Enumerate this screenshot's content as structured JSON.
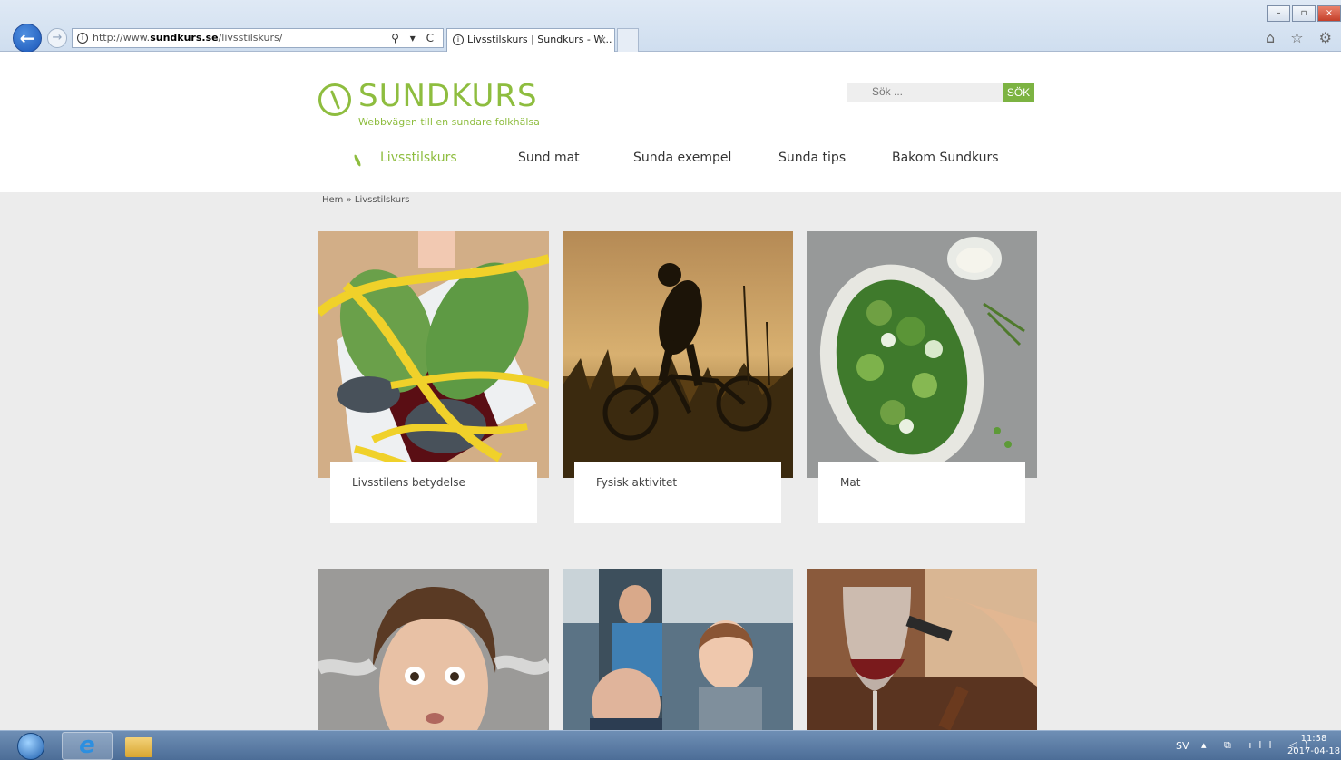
{
  "browser": {
    "url_prefix": "http://www.",
    "url_domain": "sundkurs.se",
    "url_path": "/livsstilskurs/",
    "address_tools": "⚲ ▾ C",
    "tab_title": "Livsstilskurs | Sundkurs - W...",
    "tab_close": "×",
    "win_minimize": "–",
    "win_restore": "▫",
    "win_close": "×",
    "chrome_icons": "⌂ ☆ ⚙"
  },
  "site": {
    "logo_text": "SUNDKURS",
    "tagline": "Webbvägen till en sundare folkhälsa",
    "search_placeholder": "Sök ...",
    "search_button": "SÖK",
    "nav": [
      {
        "label": "Livsstilskurs"
      },
      {
        "label": "Sund mat"
      },
      {
        "label": "Sunda exempel"
      },
      {
        "label": "Sunda tips"
      },
      {
        "label": "Bakom Sundkurs"
      }
    ],
    "breadcrumb": "Hem » Livsstilskurs"
  },
  "cards": [
    {
      "caption": "Livsstilens betydelse"
    },
    {
      "caption": "Fysisk aktivitet"
    },
    {
      "caption": "Mat"
    },
    {
      "caption": ""
    },
    {
      "caption": ""
    },
    {
      "caption": ""
    }
  ],
  "taskbar": {
    "lang": "SV",
    "tray_icons": "▴ ⧉ ıll ◁)",
    "time": "11:58",
    "date": "2017-04-18"
  }
}
